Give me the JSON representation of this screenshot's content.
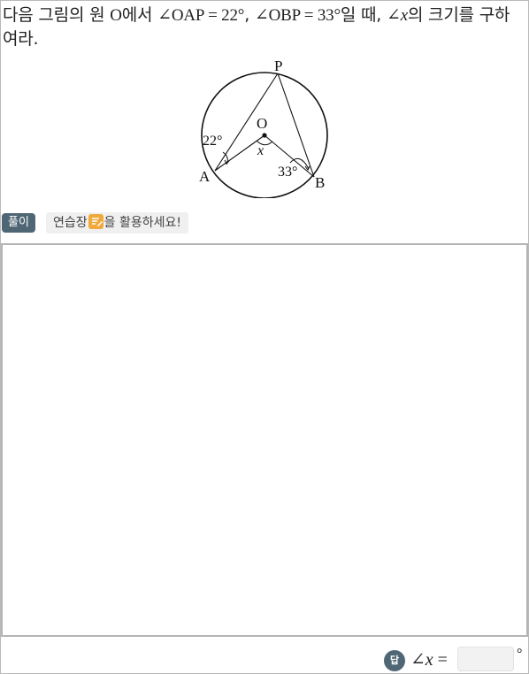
{
  "question": {
    "part1": "다음 그림의 원 ",
    "circle_name": "O",
    "part2": "에서 ",
    "given1": "∠OAP = 22°",
    "comma1": ", ",
    "given2": "∠OBP = 33°",
    "part3": "일 때, ",
    "angle_prefix": "∠",
    "var": "x",
    "part4": "의 크기를 구하여라."
  },
  "figure": {
    "label_P": "P",
    "label_O": "O",
    "label_A": "A",
    "label_B": "B",
    "label_x": "x",
    "angle_A": "22°",
    "angle_B": "33°"
  },
  "solution": {
    "badge": "풀이",
    "hint_before": "연습장",
    "hint_after": "을 활용하세요!",
    "icon": "pencil-notepad-icon"
  },
  "answer": {
    "badge": "답",
    "label_prefix": "∠",
    "label_var": "x",
    "label_eq": " =",
    "value": "",
    "unit": "°"
  }
}
